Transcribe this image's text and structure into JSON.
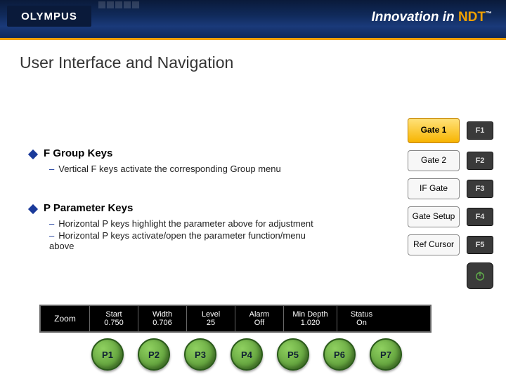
{
  "header": {
    "logo_text": "OLYMPUS",
    "tagline_prefix": "Innovation in ",
    "tagline_ndt": "NDT",
    "tagline_tm": "™"
  },
  "title": "User Interface and Navigation",
  "sections": [
    {
      "heading": "F Group Keys",
      "subs": [
        "Vertical F keys activate the corresponding Group menu"
      ]
    },
    {
      "heading": "P Parameter Keys",
      "subs": [
        "Horizontal P keys highlight the parameter above for adjustment",
        "Horizontal P keys activate/open the parameter function/menu above"
      ]
    }
  ],
  "tabs": [
    {
      "label": "Gate 1",
      "selected": true
    },
    {
      "label": "Gate 2",
      "selected": false
    },
    {
      "label": "IF Gate",
      "selected": false
    },
    {
      "label": "Gate Setup",
      "selected": false
    },
    {
      "label": "Ref Cursor",
      "selected": false
    }
  ],
  "fkeys": [
    "F1",
    "F2",
    "F3",
    "F4",
    "F5"
  ],
  "param_bar": {
    "first": "Zoom",
    "cells": [
      {
        "lbl": "Start",
        "val": "0.750"
      },
      {
        "lbl": "Width",
        "val": "0.706"
      },
      {
        "lbl": "Level",
        "val": "25"
      },
      {
        "lbl": "Alarm",
        "val": "Off"
      },
      {
        "lbl": "Min Depth",
        "val": "1.020"
      },
      {
        "lbl": "Status",
        "val": "On"
      }
    ]
  },
  "pbuttons": [
    "P1",
    "P2",
    "P3",
    "P4",
    "P5",
    "P6",
    "P7"
  ]
}
